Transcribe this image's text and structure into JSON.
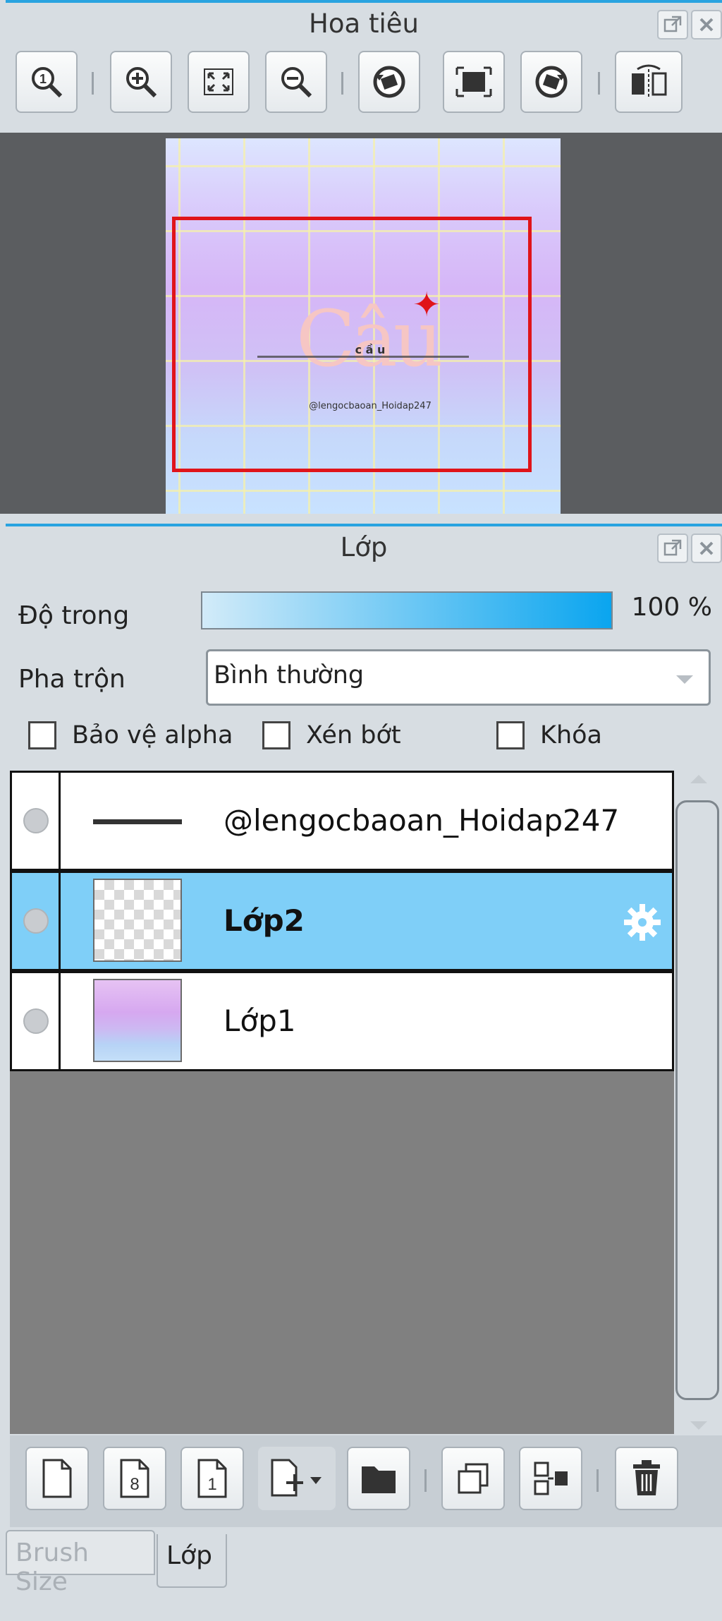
{
  "navigator": {
    "title": "Hoa tiêu",
    "tools": [
      {
        "icon": "zoom-actual-icon"
      },
      {
        "icon": "zoom-in-icon"
      },
      {
        "icon": "fit-screen-icon"
      },
      {
        "icon": "zoom-out-icon"
      },
      {
        "icon": "rotate-left-icon"
      },
      {
        "icon": "reset-view-icon"
      },
      {
        "icon": "rotate-right-icon"
      },
      {
        "icon": "flip-horizontal-icon"
      }
    ],
    "preview": {
      "artwork_word": "Câu",
      "artwork_small": "@lengocbaoan_Hoidap247",
      "artwork_letters": "c   ầ   u"
    }
  },
  "layers": {
    "title": "Lớp",
    "opacity_label": "Độ trong",
    "opacity_value": "100 %",
    "opacity_percent": 100,
    "blend_label": "Pha trộn",
    "blend_value": "Bình thường",
    "checkbox_alpha": "Bảo vệ alpha",
    "checkbox_clip": "Xén bớt",
    "checkbox_lock": "Khóa",
    "items": [
      {
        "name": "@lengocbaoan_Hoidap247",
        "selected": false,
        "thumb": "text"
      },
      {
        "name": "Lớp2",
        "selected": true,
        "thumb": "checker"
      },
      {
        "name": "Lớp1",
        "selected": false,
        "thumb": "gradient"
      }
    ],
    "bottom_tools": [
      {
        "icon": "new-layer-icon"
      },
      {
        "icon": "new-8bit-layer-icon",
        "label": "8"
      },
      {
        "icon": "new-1bit-layer-icon",
        "label": "1"
      },
      {
        "icon": "add-layer-dropdown-icon"
      },
      {
        "icon": "folder-icon"
      },
      {
        "icon": "duplicate-layer-icon"
      },
      {
        "icon": "merge-down-icon"
      },
      {
        "icon": "trash-icon"
      }
    ]
  },
  "tabs": [
    {
      "label": "Brush Size",
      "active": false
    },
    {
      "label": "Lớp",
      "active": true
    }
  ],
  "colors": {
    "accent": "#29a3e0",
    "selected_row": "#7fcff8",
    "nav_rect": "#e0141a"
  }
}
